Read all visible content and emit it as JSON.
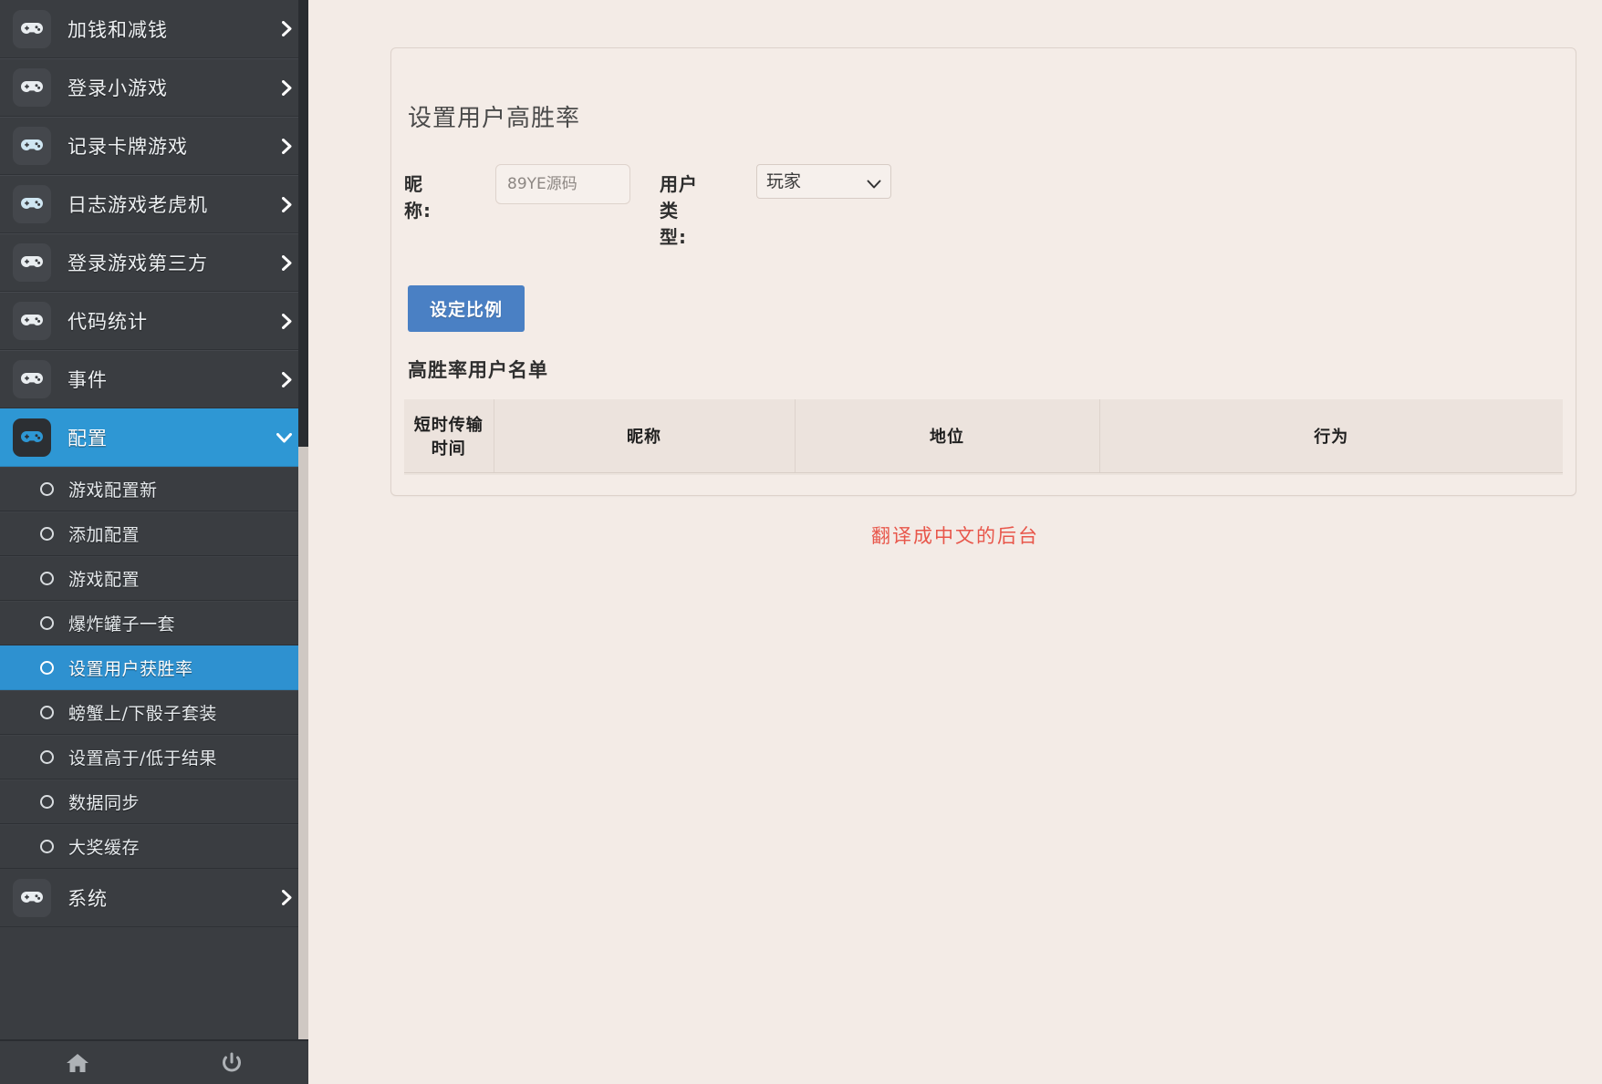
{
  "sidebar": {
    "items": [
      {
        "label": "加钱和减钱",
        "icon": "gamepad-icon",
        "caret": "chevron-right-icon",
        "active": false
      },
      {
        "label": "登录小游戏",
        "icon": "gamepad-icon",
        "caret": "chevron-right-icon",
        "active": false
      },
      {
        "label": "记录卡牌游戏",
        "icon": "gamepad-icon",
        "caret": "chevron-right-icon",
        "active": false
      },
      {
        "label": "日志游戏老虎机",
        "icon": "gamepad-icon",
        "caret": "chevron-right-icon",
        "active": false
      },
      {
        "label": "登录游戏第三方",
        "icon": "gamepad-icon",
        "caret": "chevron-right-icon",
        "active": false
      },
      {
        "label": "代码统计",
        "icon": "gamepad-icon",
        "caret": "chevron-right-icon",
        "active": false
      },
      {
        "label": "事件",
        "icon": "gamepad-icon",
        "caret": "chevron-right-icon",
        "active": false
      },
      {
        "label": "配置",
        "icon": "gamepad-icon",
        "caret": "chevron-down-icon",
        "active": true
      }
    ],
    "subitems": [
      {
        "label": "游戏配置新",
        "active": false
      },
      {
        "label": "添加配置",
        "active": false
      },
      {
        "label": "游戏配置",
        "active": false
      },
      {
        "label": "爆炸罐子一套",
        "active": false
      },
      {
        "label": "设置用户获胜率",
        "active": true
      },
      {
        "label": "螃蟹上/下骰子套装",
        "active": false
      },
      {
        "label": "设置高于/低于结果",
        "active": false
      },
      {
        "label": "数据同步",
        "active": false
      },
      {
        "label": "大奖缓存",
        "active": false
      }
    ],
    "system_item": {
      "label": "系统",
      "icon": "gamepad-icon",
      "caret": "chevron-right-icon"
    },
    "footer": {
      "home": "home-icon",
      "power": "power-icon"
    },
    "colors": {
      "background": "#3a3d41",
      "active": "#2e97d4",
      "text": "#eef1f3"
    }
  },
  "main": {
    "panel_title": "设置用户高胜率",
    "form": {
      "nickname_label": "昵称:",
      "nickname_placeholder": "89YE源码",
      "nickname_value": "",
      "usertype_label": "用户类型:",
      "usertype_selected": "玩家",
      "usertype_options": [
        "玩家"
      ],
      "submit_label": "设定比例"
    },
    "list": {
      "title": "高胜率用户名单",
      "columns": [
        "短时传输时间",
        "昵称",
        "地位",
        "行为"
      ],
      "rows": []
    },
    "notice": "翻译成中文的后台",
    "colors": {
      "background": "#f3ebe6",
      "panel": "#f4ece7",
      "button": "#4a80c4",
      "notice": "#e8564a",
      "table_header": "#ece3dd"
    }
  }
}
